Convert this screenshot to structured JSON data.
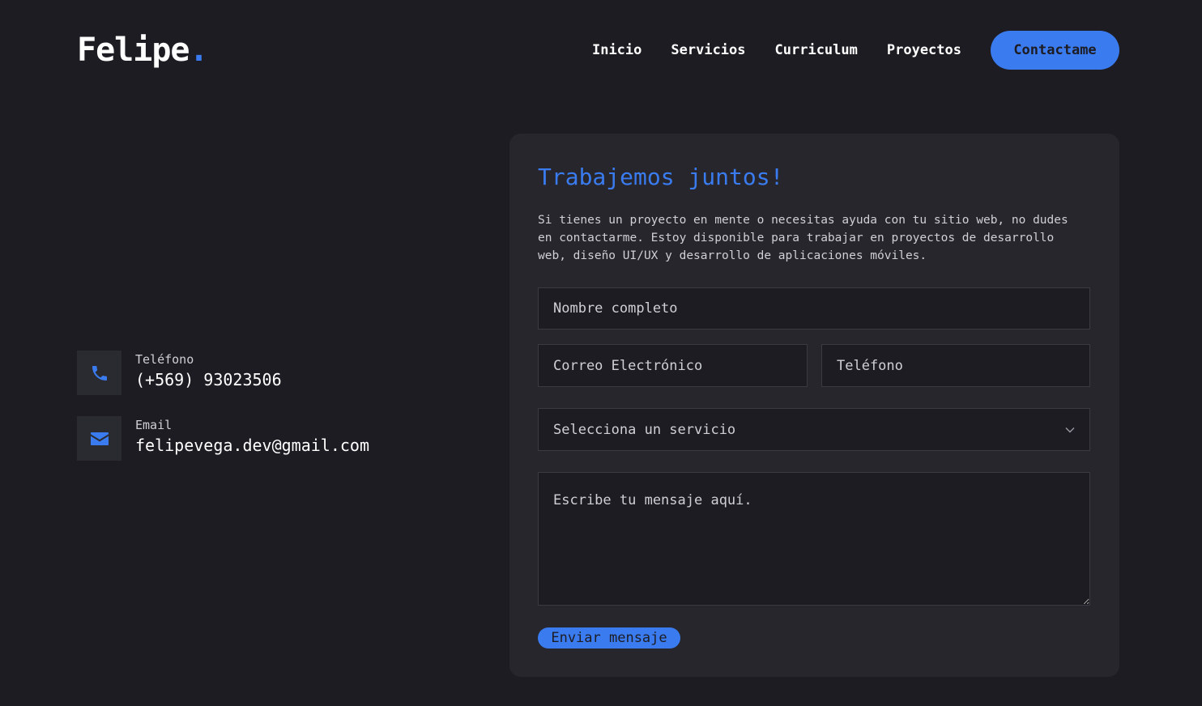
{
  "header": {
    "logo_text": "Felipe",
    "logo_dot": ".",
    "nav": [
      "Inicio",
      "Servicios",
      "Curriculum",
      "Proyectos"
    ],
    "cta_label": "Contactame"
  },
  "contact_info": {
    "phone": {
      "label": "Teléfono",
      "value": "(+569) 93023506",
      "icon": "phone-icon"
    },
    "email": {
      "label": "Email",
      "value": "felipevega.dev@gmail.com",
      "icon": "envelope-icon"
    }
  },
  "form": {
    "title": "Trabajemos juntos!",
    "description": "Si tienes un proyecto en mente o necesitas ayuda con tu sitio web, no dudes en contactarme. Estoy disponible para trabajar en proyectos de desarrollo web, diseño UI/UX y desarrollo de aplicaciones móviles.",
    "name_placeholder": "Nombre completo",
    "email_placeholder": "Correo Electrónico",
    "phone_placeholder": "Teléfono",
    "service_selected": "Selecciona un servicio",
    "message_placeholder": "Escribe tu mensaje aquí.",
    "submit_label": "Enviar mensaje"
  },
  "colors": {
    "background": "#1d1c23",
    "card": "#27262c",
    "accent": "#3a7cf0",
    "text": "#ffffff"
  }
}
